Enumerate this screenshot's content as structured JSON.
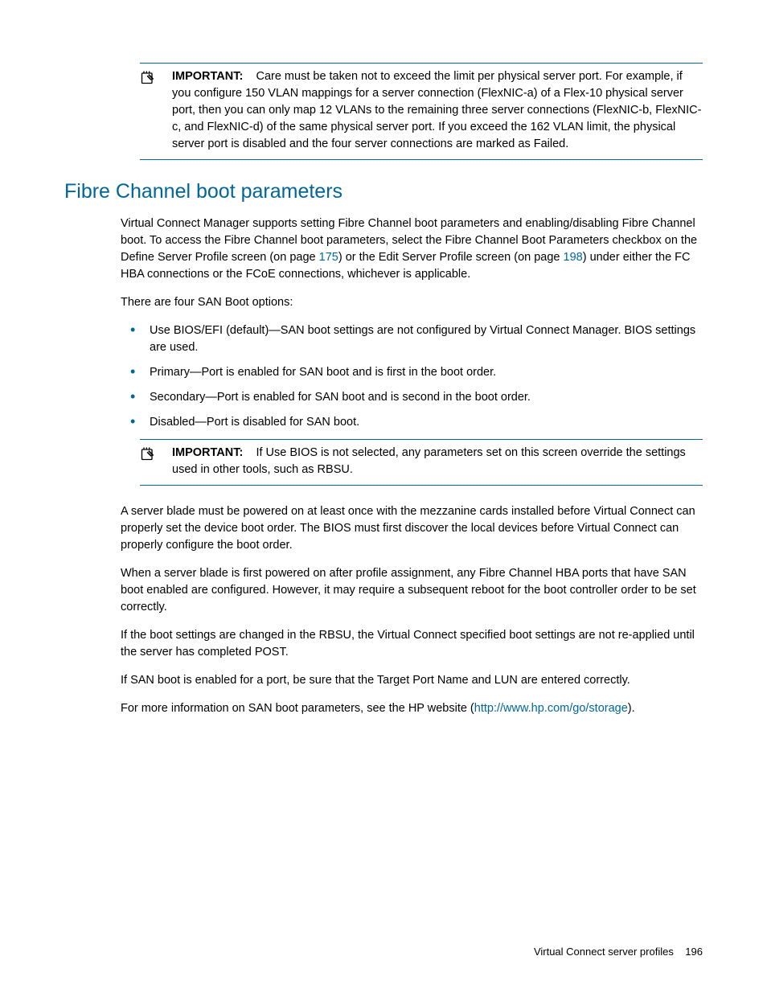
{
  "callout1": {
    "label": "IMPORTANT:",
    "text": "Care must be taken not to exceed the limit per physical server port. For example, if you configure 150 VLAN mappings for a server connection (FlexNIC-a) of a Flex-10 physical server port, then you can only map 12 VLANs to the remaining three server connections (FlexNIC-b, FlexNIC-c, and FlexNIC-d) of the same physical server port. If you exceed the 162 VLAN limit, the physical server port is disabled and the four server connections are marked as Failed."
  },
  "heading": "Fibre Channel boot parameters",
  "intro": {
    "part1": "Virtual Connect Manager supports setting Fibre Channel boot parameters and enabling/disabling Fibre Channel boot. To access the Fibre Channel boot parameters, select the Fibre Channel Boot Parameters checkbox on the Define Server Profile screen (on page ",
    "link1": "175",
    "part2": ") or the Edit Server Profile screen (on page ",
    "link2": "198",
    "part3": ") under either the FC HBA connections or the FCoE connections, whichever is applicable."
  },
  "options_intro": "There are four SAN Boot options:",
  "options": [
    "Use BIOS/EFI (default)—SAN boot settings are not configured by Virtual Connect Manager. BIOS settings are used.",
    "Primary—Port is enabled for SAN boot and is first in the boot order.",
    "Secondary—Port is enabled for SAN boot and is second in the boot order.",
    "Disabled—Port is disabled for SAN boot."
  ],
  "callout2": {
    "label": "IMPORTANT:",
    "text": "If Use BIOS is not selected, any parameters set on this screen override the settings used in other tools, such as RBSU."
  },
  "para1": "A server blade must be powered on at least once with the mezzanine cards installed before Virtual Connect can properly set the device boot order. The BIOS must first discover the local devices before Virtual Connect can properly configure the boot order.",
  "para2": "When a server blade is first powered on after profile assignment, any Fibre Channel HBA ports that have SAN boot enabled are configured. However, it may require a subsequent reboot for the boot controller order to be set correctly.",
  "para3": "If the boot settings are changed in the RBSU, the Virtual Connect specified boot settings are not re-applied until the server has completed POST.",
  "para4": "If SAN boot is enabled for a port, be sure that the Target Port Name and LUN are entered correctly.",
  "para5": {
    "part1": "For more information on SAN boot parameters, see the HP website (",
    "link": "http://www.hp.com/go/storage",
    "part2": ")."
  },
  "footer": {
    "section": "Virtual Connect server profiles",
    "page": "196"
  }
}
